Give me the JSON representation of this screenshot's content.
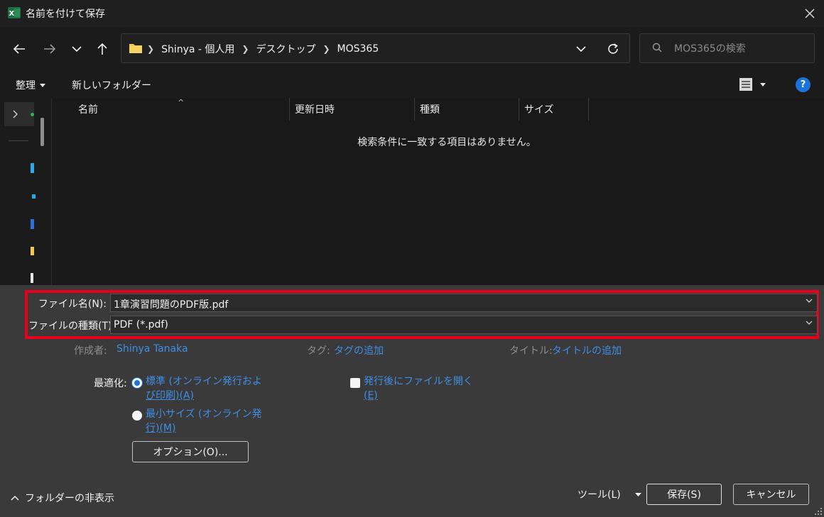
{
  "window": {
    "title": "名前を付けて保存",
    "app_icon": "excel-icon",
    "close_icon": "close-icon"
  },
  "nav": {
    "back_icon": "back-arrow-icon",
    "forward_icon": "forward-arrow-icon",
    "recent_icon": "chevron-down-icon",
    "up_icon": "up-arrow-icon",
    "breadcrumbs": [
      "Shinya - 個人用",
      "デスクトップ",
      "MOS365"
    ],
    "search_placeholder": "MOS365の検索"
  },
  "toolbar": {
    "organize_label": "整理",
    "new_folder_label": "新しいフォルダー",
    "help_label": "?"
  },
  "file_list": {
    "columns": [
      "名前",
      "更新日時",
      "種類",
      "サイズ"
    ],
    "empty_message": "検索条件に一致する項目はありません。"
  },
  "form": {
    "filename_label": "ファイル名(N):",
    "filename_value": "1章演習問題のPDF版.pdf",
    "filetype_label": "ファイルの種類(T):",
    "filetype_value": "PDF (*.pdf)",
    "author_label": "作成者:",
    "author_value": "Shinya Tanaka",
    "tags_label": "タグ:",
    "tags_value": "タグの追加",
    "title_label": "タイトル:",
    "title_value": "タイトルの追加"
  },
  "options": {
    "optimize_label": "最適化:",
    "standard_line1": "標準 (オンライン発行およ",
    "standard_line2": "び印刷)(A)",
    "minimum_line1": "最小サイズ (オンライン発",
    "minimum_line2": "行)(M)",
    "open_after_line1": "発行後にファイルを開く",
    "open_after_line2": "(E)",
    "options_button": "オプション(O)..."
  },
  "footer": {
    "hide_folders": "フォルダーの非表示",
    "tools_label": "ツール(L)",
    "save_button": "保存(S)",
    "cancel_button": "キャンセル"
  },
  "colors": {
    "highlight": "#e8001d",
    "link": "#3f8ee6",
    "accent": "#1a73d9"
  }
}
